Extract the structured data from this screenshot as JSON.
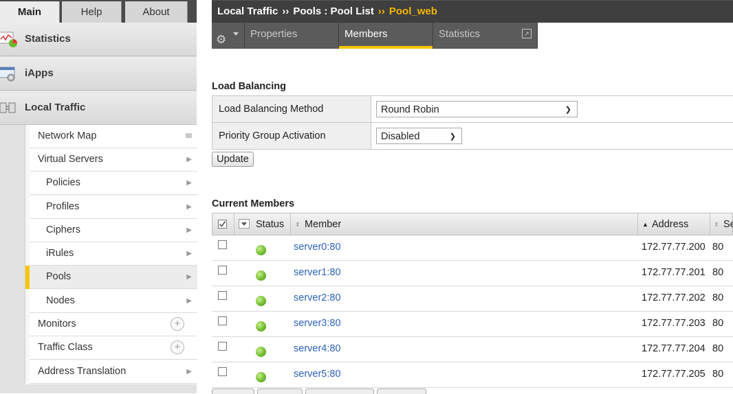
{
  "nav_tabs": [
    {
      "label": "Main",
      "active": true
    },
    {
      "label": "Help",
      "active": false
    },
    {
      "label": "About",
      "active": false
    }
  ],
  "sections": [
    {
      "label": "Statistics",
      "icon": "statistics-icon"
    },
    {
      "label": "iApps",
      "icon": "iapps-icon"
    },
    {
      "label": "Local Traffic",
      "icon": "local-traffic-icon"
    }
  ],
  "submenu": [
    {
      "label": "Network Map",
      "child": false,
      "control": "map"
    },
    {
      "label": "Virtual Servers",
      "child": false,
      "control": "arrow"
    },
    {
      "label": "Policies",
      "child": true,
      "control": "arrow"
    },
    {
      "label": "Profiles",
      "child": true,
      "control": "arrow"
    },
    {
      "label": "Ciphers",
      "child": true,
      "control": "arrow"
    },
    {
      "label": "iRules",
      "child": true,
      "control": "arrow"
    },
    {
      "label": "Pools",
      "child": true,
      "control": "arrow",
      "selected": true
    },
    {
      "label": "Nodes",
      "child": true,
      "control": "arrow"
    },
    {
      "label": "Monitors",
      "child": false,
      "control": "plus"
    },
    {
      "label": "Traffic Class",
      "child": false,
      "control": "plus"
    },
    {
      "label": "Address Translation",
      "child": false,
      "control": "arrow"
    }
  ],
  "breadcrumb": {
    "part1": "Local Traffic",
    "sep": "››",
    "part2": "Pools : Pool List",
    "current": "Pool_web"
  },
  "page_tabs": {
    "properties": "Properties",
    "members": "Members",
    "statistics": "Statistics"
  },
  "load_balancing": {
    "title": "Load Balancing",
    "method_label": "Load Balancing Method",
    "method_value": "Round Robin",
    "priority_label": "Priority Group Activation",
    "priority_value": "Disabled",
    "update_label": "Update"
  },
  "members": {
    "title": "Current Members",
    "headers": {
      "status": "Status",
      "member": "Member",
      "address": "Address",
      "service": "Se"
    },
    "rows": [
      {
        "member": "server0:80",
        "address": "172.77.77.200",
        "port": "80",
        "status": "available"
      },
      {
        "member": "server1:80",
        "address": "172.77.77.201",
        "port": "80",
        "status": "available"
      },
      {
        "member": "server2:80",
        "address": "172.77.77.202",
        "port": "80",
        "status": "available"
      },
      {
        "member": "server3:80",
        "address": "172.77.77.203",
        "port": "80",
        "status": "available"
      },
      {
        "member": "server4:80",
        "address": "172.77.77.204",
        "port": "80",
        "status": "available"
      },
      {
        "member": "server5:80",
        "address": "172.77.77.205",
        "port": "80",
        "status": "available"
      }
    ]
  },
  "colors": {
    "accent": "#f6c500",
    "link": "#2b62b8",
    "status_available": "#6cb82c"
  }
}
